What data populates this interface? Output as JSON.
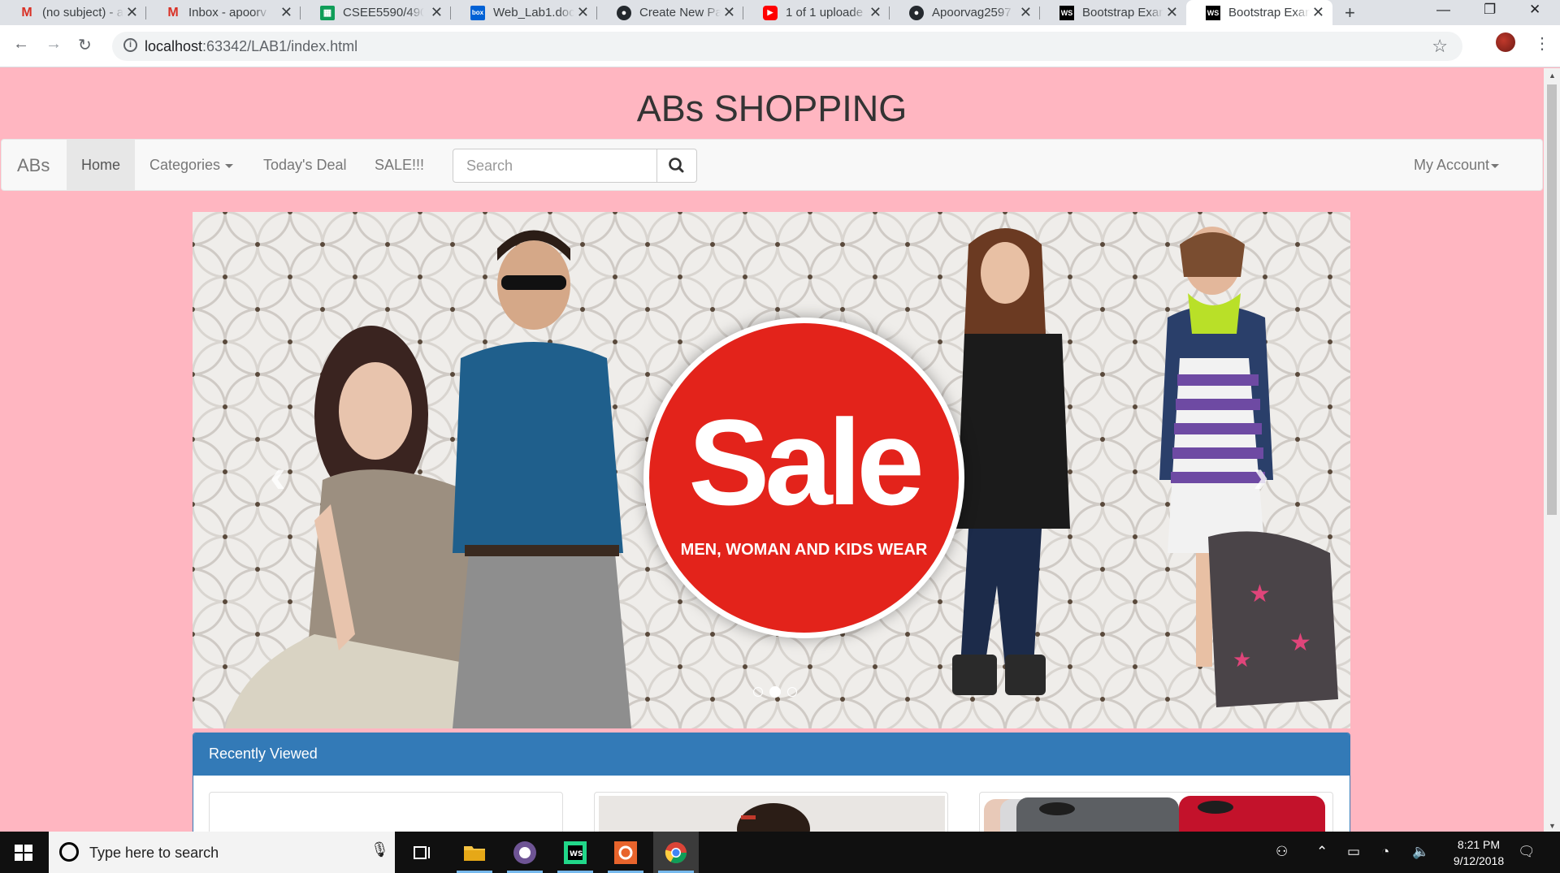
{
  "browser": {
    "tabs": [
      {
        "title": "(no subject) - a",
        "icon": "gmail-icon"
      },
      {
        "title": "Inbox - apoorv",
        "icon": "gmail-icon"
      },
      {
        "title": "CSEE5590/490",
        "icon": "sheets-icon"
      },
      {
        "title": "Web_Lab1.docx",
        "icon": "box-icon"
      },
      {
        "title": "Create New Pa",
        "icon": "github-icon"
      },
      {
        "title": "1 of 1 uploade",
        "icon": "youtube-icon"
      },
      {
        "title": "Apoorvag2597",
        "icon": "github-icon"
      },
      {
        "title": "Bootstrap Exan",
        "icon": "webstorm-icon"
      },
      {
        "title": "Bootstrap Exan",
        "icon": "webstorm-icon",
        "active": true
      }
    ],
    "url_host": "localhost",
    "url_rest": ":63342/LAB1/index.html"
  },
  "site": {
    "title": "ABs SHOPPING"
  },
  "navbar": {
    "brand": "ABs",
    "items": [
      "Home",
      "Categories",
      "Today's Deal",
      "SALE!!!"
    ],
    "search_placeholder": "Search",
    "account": "My Account"
  },
  "carousel": {
    "sale_word": "Sale",
    "sale_sub": "MEN, WOMAN AND KIDS WEAR",
    "active_slide": 2,
    "slide_count": 3
  },
  "panel": {
    "title": "Recently Viewed"
  },
  "taskbar": {
    "search_text": "Type here to search",
    "time": "8:21 PM",
    "date": "9/12/2018"
  },
  "colors": {
    "page_bg": "#ffb6c1",
    "panel_primary": "#337ab7",
    "sale_red": "#e3231b"
  }
}
